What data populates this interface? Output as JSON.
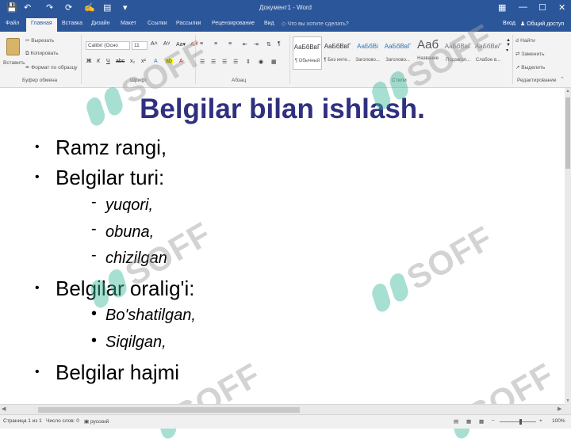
{
  "titlebar": {
    "title": "Документ1 - Word",
    "quick_access": [
      "save-icon",
      "undo-icon",
      "redo-icon",
      "customize-icon"
    ],
    "window_controls": [
      "ribbon-options-icon",
      "minimize-icon",
      "maximize-icon",
      "close-icon"
    ]
  },
  "tabs": {
    "items": [
      "Файл",
      "Главная",
      "Вставка",
      "Дизайн",
      "Макет",
      "Ссылки",
      "Рассылки",
      "Рецензирование",
      "Вид"
    ],
    "active_index": 1,
    "tell_me": "Что вы хотите сделать?",
    "signin": "Вход",
    "share": "Общий доступ"
  },
  "ribbon": {
    "clipboard": {
      "paste": "Вставить",
      "cut": "Вырезать",
      "copy": "Копировать",
      "format_painter": "Формат по образцу",
      "label": "Буфер обмена"
    },
    "font": {
      "name": "Calibri (Осно",
      "size": "11",
      "label": "Шрифт"
    },
    "paragraph": {
      "label": "Абзац"
    },
    "styles": {
      "items": [
        {
          "preview": "АаБбВвГ",
          "name": "¶ Обычный"
        },
        {
          "preview": "АаБбВвГ",
          "name": "¶ Без инте..."
        },
        {
          "preview": "АаБбВі",
          "name": "Заголово..."
        },
        {
          "preview": "АаБбВвГ",
          "name": "Заголово..."
        },
        {
          "preview": "Ааб",
          "name": "Название"
        },
        {
          "preview": "АаБбВвГ",
          "name": "Подзагол..."
        },
        {
          "preview": "АаБбВвГ",
          "name": "Слабое в..."
        }
      ],
      "label": "Стили"
    },
    "editing": {
      "find": "Найти",
      "replace": "Заменить",
      "select": "Выделить",
      "label": "Редактирование"
    }
  },
  "document": {
    "title": "Belgilar bilan ishlash.",
    "bullets": [
      {
        "level": 1,
        "marker": "•",
        "text": "Ramz rangi,"
      },
      {
        "level": 1,
        "marker": "•",
        "text": "Belgilar turi:"
      },
      {
        "level": 2,
        "marker": "-",
        "text": "yuqori,"
      },
      {
        "level": 2,
        "marker": "-",
        "text": "obuna,"
      },
      {
        "level": 2,
        "marker": "-",
        "text": "chizilgan"
      },
      {
        "level": 1,
        "marker": "•",
        "text": "Belgilar oralig'i:"
      },
      {
        "level": 2,
        "marker": "•",
        "text": "Bo'shatilgan,"
      },
      {
        "level": 2,
        "marker": "•",
        "text": "Siqilgan,"
      },
      {
        "level": 1,
        "marker": "•",
        "text": "Belgilar hajmi"
      }
    ]
  },
  "statusbar": {
    "page": "Страница 1 из 1",
    "words": "Число слов: 0",
    "language": "русский",
    "zoom": "100%"
  },
  "watermark": {
    "text": "SOFF",
    "color": "#3fb99e"
  },
  "colors": {
    "accent": "#2b579a",
    "title_text": "#303080",
    "ribbon_bg": "#f3f3f3"
  }
}
